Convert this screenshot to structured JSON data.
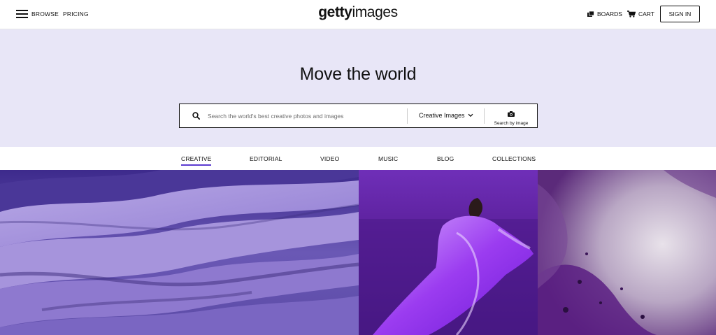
{
  "header": {
    "browse_label": "BROWSE",
    "pricing_label": "PRICING",
    "logo_bold": "getty",
    "logo_light": "images",
    "boards_label": "BOARDS",
    "cart_label": "CART",
    "signin_label": "SIGN IN"
  },
  "hero": {
    "title": "Move the world",
    "search_placeholder": "Search the world's best creative photos and images",
    "dropdown_label": "Creative Images",
    "search_by_image_label": "Search by image",
    "background": "#e8e6f7"
  },
  "tabs": [
    {
      "label": "CREATIVE",
      "active": true
    },
    {
      "label": "EDITORIAL",
      "active": false
    },
    {
      "label": "VIDEO",
      "active": false
    },
    {
      "label": "MUSIC",
      "active": false
    },
    {
      "label": "BLOG",
      "active": false
    },
    {
      "label": "COLLECTIONS",
      "active": false
    }
  ],
  "colors": {
    "accent": "#5c3bd1"
  }
}
